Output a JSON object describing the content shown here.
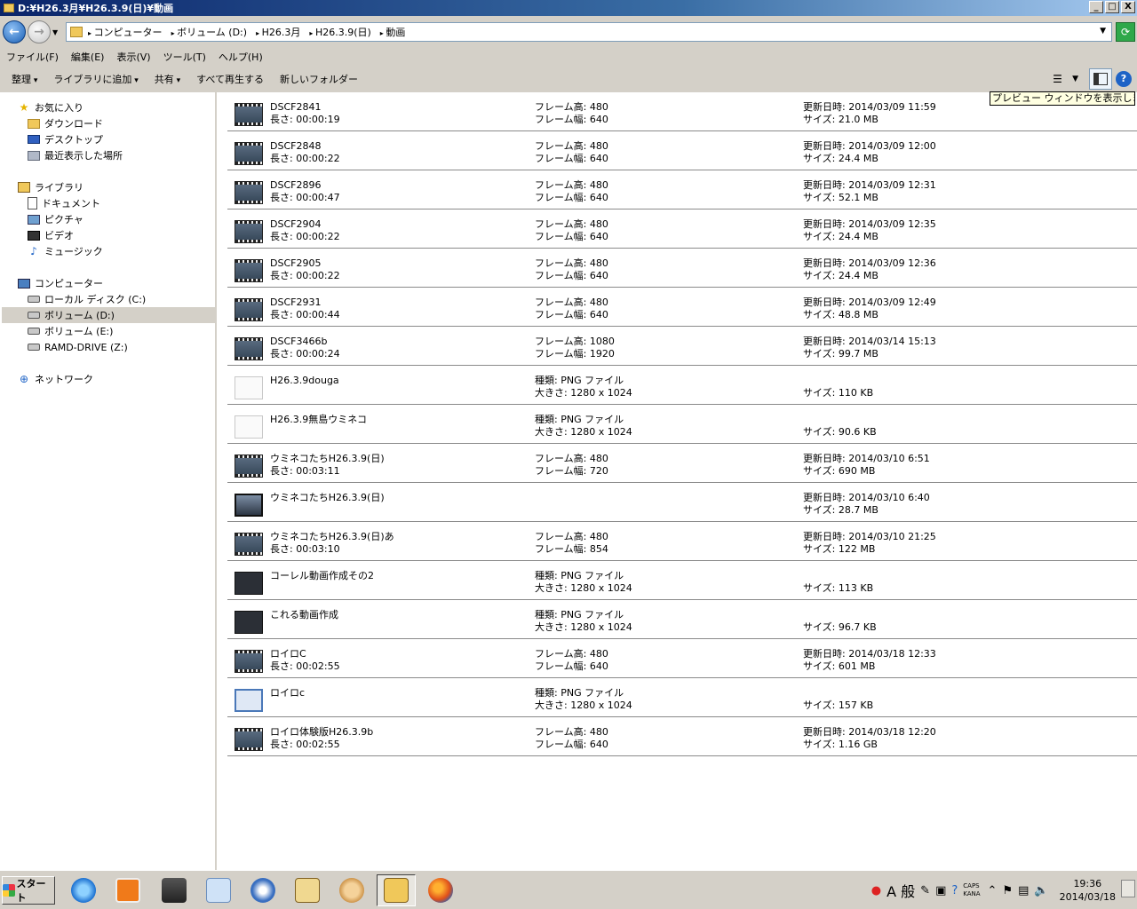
{
  "window": {
    "title": "D:¥H26.3月¥H26.3.9(日)¥動画",
    "minimize": "_",
    "maximize": "□",
    "close": "X"
  },
  "address": {
    "crumbs": [
      "コンピューター",
      "ボリューム (D:)",
      "H26.3月",
      "H26.3.9(日)",
      "動画"
    ]
  },
  "menu": [
    "ファイル(F)",
    "編集(E)",
    "表示(V)",
    "ツール(T)",
    "ヘルプ(H)"
  ],
  "commands": {
    "organize": "整理",
    "add_library": "ライブラリに追加",
    "share": "共有",
    "play_all": "すべて再生する",
    "new_folder": "新しいフォルダー"
  },
  "tooltip": "プレビュー ウィンドウを表示します。",
  "nav": {
    "favorites": "お気に入り",
    "downloads": "ダウンロード",
    "desktop": "デスクトップ",
    "recent": "最近表示した場所",
    "libraries": "ライブラリ",
    "documents": "ドキュメント",
    "pictures": "ピクチャ",
    "videos": "ビデオ",
    "music": "ミュージック",
    "computer": "コンピューター",
    "drive_c": "ローカル ディスク (C:)",
    "drive_d": "ボリューム (D:)",
    "drive_e": "ボリューム (E:)",
    "drive_z": "RAMD-DRIVE (Z:)",
    "network": "ネットワーク"
  },
  "files": [
    {
      "name": "DSCF2841",
      "sub": "長さ: 00:00:19",
      "c2a": "フレーム高: 480",
      "c2b": "フレーム幅: 640",
      "c3a": "更新日時: 2014/03/09 11:59",
      "c3b": "サイズ: 21.0 MB",
      "thumb": "video"
    },
    {
      "name": "DSCF2848",
      "sub": "長さ: 00:00:22",
      "c2a": "フレーム高: 480",
      "c2b": "フレーム幅: 640",
      "c3a": "更新日時: 2014/03/09 12:00",
      "c3b": "サイズ: 24.4 MB",
      "thumb": "video"
    },
    {
      "name": "DSCF2896",
      "sub": "長さ: 00:00:47",
      "c2a": "フレーム高: 480",
      "c2b": "フレーム幅: 640",
      "c3a": "更新日時: 2014/03/09 12:31",
      "c3b": "サイズ: 52.1 MB",
      "thumb": "video"
    },
    {
      "name": "DSCF2904",
      "sub": "長さ: 00:00:22",
      "c2a": "フレーム高: 480",
      "c2b": "フレーム幅: 640",
      "c3a": "更新日時: 2014/03/09 12:35",
      "c3b": "サイズ: 24.4 MB",
      "thumb": "video"
    },
    {
      "name": "DSCF2905",
      "sub": "長さ: 00:00:22",
      "c2a": "フレーム高: 480",
      "c2b": "フレーム幅: 640",
      "c3a": "更新日時: 2014/03/09 12:36",
      "c3b": "サイズ: 24.4 MB",
      "thumb": "video"
    },
    {
      "name": "DSCF2931",
      "sub": "長さ: 00:00:44",
      "c2a": "フレーム高: 480",
      "c2b": "フレーム幅: 640",
      "c3a": "更新日時: 2014/03/09 12:49",
      "c3b": "サイズ: 48.8 MB",
      "thumb": "video"
    },
    {
      "name": "DSCF3466b",
      "sub": "長さ: 00:00:24",
      "c2a": "フレーム高: 1080",
      "c2b": "フレーム幅: 1920",
      "c3a": "更新日時: 2014/03/14 15:13",
      "c3b": "サイズ: 99.7 MB",
      "thumb": "video"
    },
    {
      "name": "H26.3.9douga",
      "sub": "",
      "c2a": "種類: PNG ファイル",
      "c2b": "大きさ: 1280 x 1024",
      "c3a": "",
      "c3b": "サイズ: 110 KB",
      "thumb": "png"
    },
    {
      "name": "H26.3.9無島ウミネコ",
      "sub": "",
      "c2a": "種類: PNG ファイル",
      "c2b": "大きさ: 1280 x 1024",
      "c3a": "",
      "c3b": "サイズ: 90.6 KB",
      "thumb": "png"
    },
    {
      "name": "ウミネコたちH26.3.9(日)",
      "sub": "長さ: 00:03:11",
      "c2a": "フレーム高: 480",
      "c2b": "フレーム幅: 720",
      "c3a": "更新日時: 2014/03/10 6:51",
      "c3b": "サイズ: 690 MB",
      "thumb": "video"
    },
    {
      "name": "ウミネコたちH26.3.9(日)",
      "sub": "",
      "c2a": "",
      "c2b": "",
      "c3a": "更新日時: 2014/03/10 6:40",
      "c3b": "サイズ: 28.7 MB",
      "thumb": "screen"
    },
    {
      "name": "ウミネコたちH26.3.9(日)あ",
      "sub": "長さ: 00:03:10",
      "c2a": "フレーム高: 480",
      "c2b": "フレーム幅: 854",
      "c3a": "更新日時: 2014/03/10 21:25",
      "c3b": "サイズ: 122 MB",
      "thumb": "video"
    },
    {
      "name": "コーレル動画作成その2",
      "sub": "",
      "c2a": "種類: PNG ファイル",
      "c2b": "大きさ: 1280 x 1024",
      "c3a": "",
      "c3b": "サイズ: 113 KB",
      "thumb": "dark"
    },
    {
      "name": "これる動画作成",
      "sub": "",
      "c2a": "種類: PNG ファイル",
      "c2b": "大きさ: 1280 x 1024",
      "c3a": "",
      "c3b": "サイズ: 96.7 KB",
      "thumb": "dark"
    },
    {
      "name": "ロイロC",
      "sub": "長さ: 00:02:55",
      "c2a": "フレーム高: 480",
      "c2b": "フレーム幅: 640",
      "c3a": "更新日時: 2014/03/18 12:33",
      "c3b": "サイズ: 601 MB",
      "thumb": "video"
    },
    {
      "name": "ロイロc",
      "sub": "",
      "c2a": "種類: PNG ファイル",
      "c2b": "大きさ: 1280 x 1024",
      "c3a": "",
      "c3b": "サイズ: 157 KB",
      "thumb": "blue"
    },
    {
      "name": "ロイロ体験版H26.3.9b",
      "sub": "長さ: 00:02:55",
      "c2a": "フレーム高: 480",
      "c2b": "フレーム幅: 640",
      "c3a": "更新日時: 2014/03/18 12:20",
      "c3b": "サイズ: 1.16 GB",
      "thumb": "video"
    }
  ],
  "taskbar": {
    "start": "スタート",
    "ime_mode": "A 般",
    "caps": "CAPS",
    "kana": "KANA",
    "time": "19:36",
    "date": "2014/03/18"
  }
}
